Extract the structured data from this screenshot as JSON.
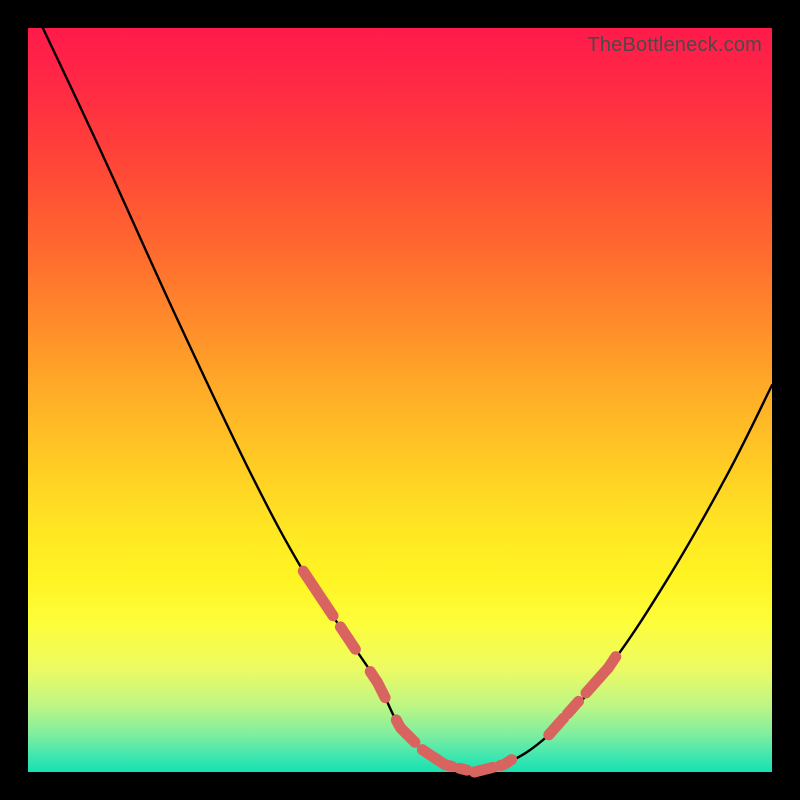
{
  "watermark": {
    "text": "TheBottleneck.com"
  },
  "colors": {
    "background": "#000000",
    "curve": "#000000",
    "overlay": "#d9635f",
    "gradient_top": "#ff1a4b",
    "gradient_bottom": "#17e1b1"
  },
  "chart_data": {
    "type": "line",
    "title": "",
    "xlabel": "",
    "ylabel": "",
    "xlim": [
      0,
      100
    ],
    "ylim": [
      0,
      100
    ],
    "grid": false,
    "legend": false,
    "series": [
      {
        "name": "bottleneck-curve",
        "x": [
          2,
          10,
          20,
          30,
          37,
          43,
          47,
          50,
          53,
          56,
          60,
          64,
          70,
          78,
          86,
          94,
          100
        ],
        "y": [
          100,
          83,
          61,
          40,
          27,
          18,
          12,
          6,
          3,
          1,
          0,
          1,
          5,
          14,
          26,
          40,
          52
        ]
      }
    ],
    "highlighted_segments": [
      {
        "x0": 37,
        "x1": 41
      },
      {
        "x0": 42,
        "x1": 44
      },
      {
        "x0": 46,
        "x1": 48
      },
      {
        "x0": 49.5,
        "x1": 52
      },
      {
        "x0": 53,
        "x1": 57
      },
      {
        "x0": 58,
        "x1": 59
      },
      {
        "x0": 60,
        "x1": 62.5
      },
      {
        "x0": 63.5,
        "x1": 65
      },
      {
        "x0": 70,
        "x1": 72
      },
      {
        "x0": 72.5,
        "x1": 74
      },
      {
        "x0": 75,
        "x1": 79
      }
    ],
    "annotations": []
  }
}
